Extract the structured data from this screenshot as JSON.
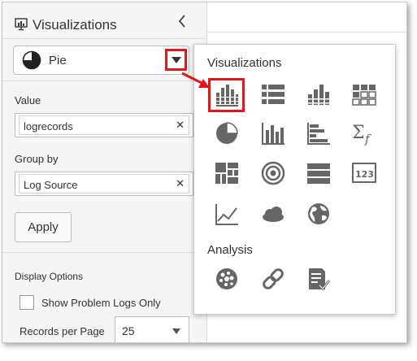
{
  "panel": {
    "title": "Visualizations",
    "collapse_icon": "chevron-left-icon",
    "type_select": {
      "value": "Pie",
      "icon": "pie-chart-icon"
    },
    "value_field": {
      "label": "Value",
      "tag": "logrecords"
    },
    "group_field": {
      "label": "Group by",
      "tag": "Log Source"
    },
    "apply_label": "Apply",
    "display_options": {
      "title": "Display Options",
      "show_problem_label": "Show Problem Logs Only",
      "records_label": "Records per Page",
      "records_value": "25"
    }
  },
  "popup": {
    "viz_title": "Visualizations",
    "viz_icons": [
      "bar-chart-icon",
      "table-icon",
      "stacked-bar-icon",
      "grid-icon",
      "pie-chart-icon",
      "histogram-icon",
      "horizontal-bar-icon",
      "summary-icon",
      "treemap-icon",
      "target-icon",
      "tiles-icon",
      "number-icon",
      "line-chart-icon",
      "cloud-icon",
      "globe-icon"
    ],
    "analysis_title": "Analysis",
    "analysis_icons": [
      "cluster-icon",
      "link-icon",
      "report-icon"
    ],
    "summary_glyph": "Σf",
    "number_glyph": "123"
  },
  "colors": {
    "highlight": "#e4141b",
    "icon_gray": "#666666"
  }
}
